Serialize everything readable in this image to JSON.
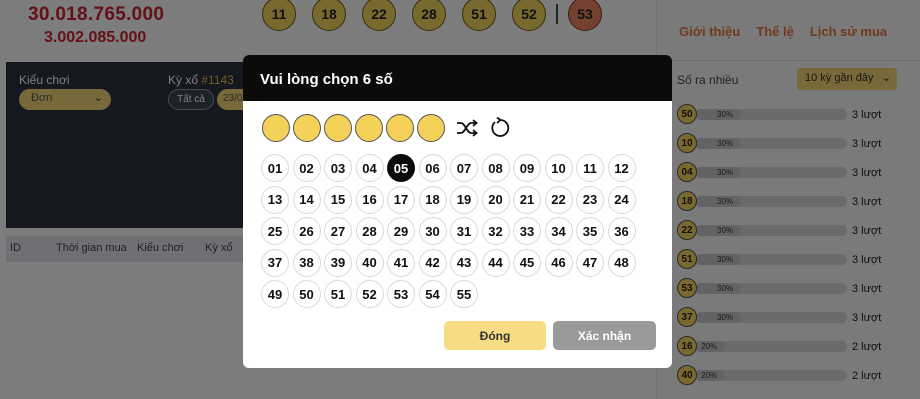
{
  "jackpot": {
    "primary": "30.018.765.000",
    "secondary": "3.002.085.000"
  },
  "latest_draw": {
    "balls": [
      "11",
      "18",
      "22",
      "28",
      "51",
      "52"
    ],
    "special": "53"
  },
  "filters": {
    "play_type_label": "Kiểu chơi",
    "play_type_value": "Đơn",
    "draw_label": "Kỳ xổ",
    "draw_number": "#1143",
    "all_label": "Tất cả",
    "date_partial": "23/0"
  },
  "table": {
    "headers": [
      "ID",
      "Thời gian mua",
      "Kiểu chơi",
      "Kỳ xổ"
    ]
  },
  "nav": {
    "links": [
      "Giới thiệu",
      "Thể lệ",
      "Lịch sử mua"
    ]
  },
  "stats": {
    "title": "Số ra nhiều",
    "period": "10 kỳ gần đây",
    "rows": [
      {
        "ball": "50",
        "pct": "30%",
        "fraction": 0.3,
        "count": "3 lượt"
      },
      {
        "ball": "10",
        "pct": "30%",
        "fraction": 0.3,
        "count": "3 lượt"
      },
      {
        "ball": "04",
        "pct": "30%",
        "fraction": 0.3,
        "count": "3 lượt"
      },
      {
        "ball": "18",
        "pct": "30%",
        "fraction": 0.3,
        "count": "3 lượt"
      },
      {
        "ball": "22",
        "pct": "30%",
        "fraction": 0.3,
        "count": "3 lượt"
      },
      {
        "ball": "51",
        "pct": "30%",
        "fraction": 0.3,
        "count": "3 lượt"
      },
      {
        "ball": "53",
        "pct": "30%",
        "fraction": 0.3,
        "count": "3 lượt"
      },
      {
        "ball": "37",
        "pct": "30%",
        "fraction": 0.3,
        "count": "3 lượt"
      },
      {
        "ball": "16",
        "pct": "20%",
        "fraction": 0.2,
        "count": "2 lượt"
      },
      {
        "ball": "40",
        "pct": "20%",
        "fraction": 0.2,
        "count": "2 lượt"
      }
    ]
  },
  "modal": {
    "title": "Vui lòng chọn 6 số",
    "pick_slots": 6,
    "numbers": [
      "01",
      "02",
      "03",
      "04",
      "05",
      "06",
      "07",
      "08",
      "09",
      "10",
      "11",
      "12",
      "13",
      "14",
      "15",
      "16",
      "17",
      "18",
      "19",
      "20",
      "21",
      "22",
      "23",
      "24",
      "25",
      "26",
      "27",
      "28",
      "29",
      "30",
      "31",
      "32",
      "33",
      "34",
      "35",
      "36",
      "37",
      "38",
      "39",
      "40",
      "41",
      "42",
      "43",
      "44",
      "45",
      "46",
      "47",
      "48",
      "49",
      "50",
      "51",
      "52",
      "53",
      "54",
      "55"
    ],
    "selected": [
      "05"
    ],
    "close_label": "Đóng",
    "confirm_label": "Xác nhận",
    "icons": {
      "shuffle": "shuffle-icon",
      "reset": "reset-icon"
    }
  }
}
